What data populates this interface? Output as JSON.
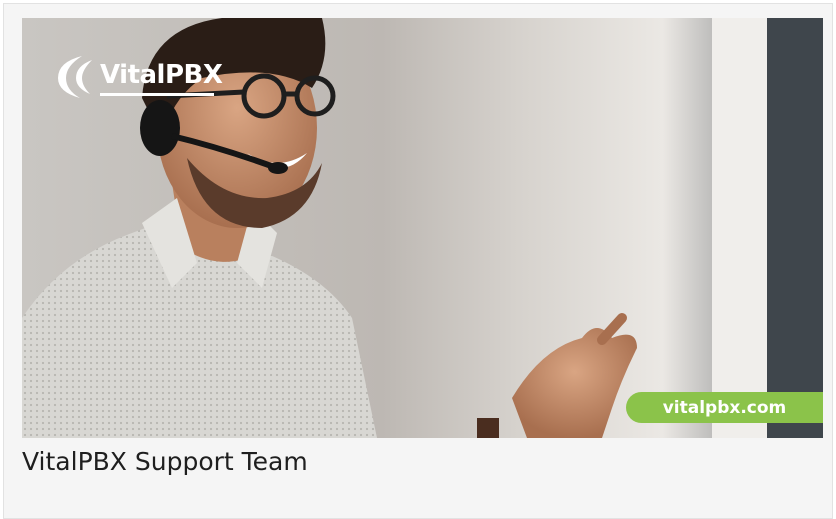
{
  "card": {
    "image": {
      "logo_text": "VitalPBX",
      "badge_text": "vitalpbx.com",
      "badge_color": "#8bc34a",
      "description_icon": "support-agent-photo"
    },
    "caption": "VitalPBX Support Team"
  }
}
